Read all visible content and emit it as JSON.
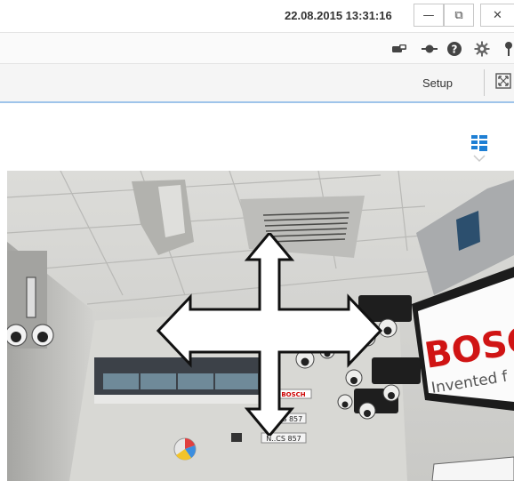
{
  "titlebar": {
    "datetime": "22.08.2015 13:31:16",
    "buttons": {
      "minimize": "—",
      "restore": "⧉",
      "close": "✕"
    }
  },
  "toolbar": {
    "icons": [
      "camera-link-icon",
      "record-dot-icon",
      "help-icon",
      "settings-gear-icon",
      "pin-icon"
    ]
  },
  "mode_bar": {
    "setup_label": "Setup"
  },
  "video": {
    "overlay": "pan-tilt-arrows",
    "scene_signage": {
      "brand": "BOSCH",
      "tagline": "Invented f",
      "sign_small": "BOSCH",
      "plate_1": "CS 857",
      "plate_2": "N..CS 857"
    }
  },
  "colors": {
    "accent_blue": "#1e7fd4",
    "tab_underline": "#9fc4ea",
    "brand_red": "#d01414"
  }
}
